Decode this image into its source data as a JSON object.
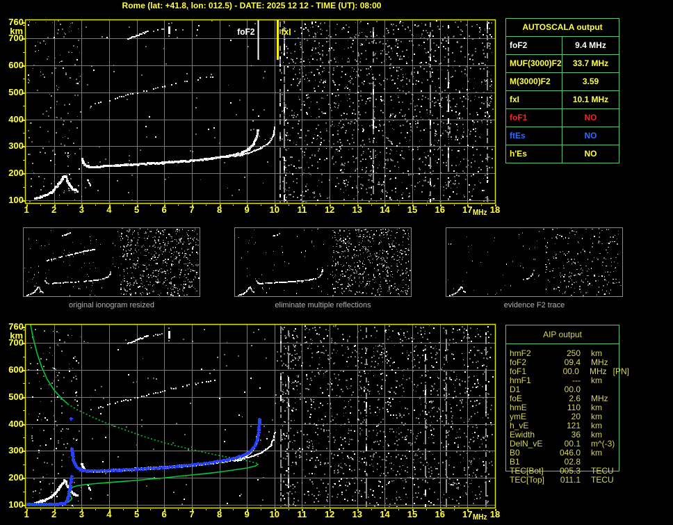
{
  "title": "Rome (lat: +41.8, lon: 012.5) - DATE: 2025 12 12 - TIME (UT): 08:00",
  "colors": {
    "yellow": "#ffff3c",
    "white": "#ffffff",
    "red": "#ff2020",
    "blue": "#2e6bff",
    "axis": "#e3e300",
    "grid": "#7a7a7a",
    "table_border": "#58c878",
    "trace_green": "#00c837",
    "trace_blue": "#2642ff",
    "caption": "#b4b4b4",
    "aip_text": "#d6d655"
  },
  "autoscala_table": {
    "title": "AUTOSCALA output",
    "rows": [
      {
        "label": "foF2",
        "value": "9.4 MHz",
        "color": "#ffffff"
      },
      {
        "label": "MUF(3000)F2",
        "value": "33.7 MHz",
        "color": "#ffff3c"
      },
      {
        "label": "M(3000)F2",
        "value": "3.59",
        "color": "#ffff3c"
      },
      {
        "label": "fxI",
        "value": "10.1 MHz",
        "color": "#ffff3c"
      },
      {
        "label": "foF1",
        "value": "NO",
        "color": "#ff2020"
      },
      {
        "label": "ftEs",
        "value": "NO",
        "color": "#2e6bff"
      },
      {
        "label": "h'Es",
        "value": "NO",
        "color": "#ffff3c"
      }
    ]
  },
  "aip_table": {
    "title": "AIP output",
    "rows": [
      {
        "label": "hmF2",
        "value": "250",
        "unit": "km",
        "note": ""
      },
      {
        "label": "foF2",
        "value": "09.4",
        "unit": "MHz",
        "note": ""
      },
      {
        "label": "foF1",
        "value": "00.0",
        "unit": "MHz",
        "note": "[PN]"
      },
      {
        "label": "hmF1",
        "value": "---",
        "unit": "km",
        "note": ""
      },
      {
        "label": "D1",
        "value": "00.0",
        "unit": "",
        "note": ""
      },
      {
        "label": "foE",
        "value": "2.6",
        "unit": "MHz",
        "note": ""
      },
      {
        "label": "hmE",
        "value": "110",
        "unit": "km",
        "note": ""
      },
      {
        "label": "ymE",
        "value": "20",
        "unit": "km",
        "note": ""
      },
      {
        "label": "h_vE",
        "value": "121",
        "unit": "km",
        "note": ""
      },
      {
        "label": "Ewidth",
        "value": "36",
        "unit": "km",
        "note": ""
      },
      {
        "label": "DelN_vE",
        "value": "00.1",
        "unit": "m^(-3)",
        "note": ""
      },
      {
        "label": "B0",
        "value": "046.0",
        "unit": "km",
        "note": ""
      },
      {
        "label": "B1",
        "value": "02.8",
        "unit": "",
        "note": ""
      },
      {
        "label": "TEC[Bot]",
        "value": "005.3",
        "unit": "TECU",
        "note": ""
      },
      {
        "label": "TEC[Top]",
        "value": "011.1",
        "unit": "TECU",
        "note": ""
      }
    ]
  },
  "thumbnails": {
    "items": [
      {
        "caption": "original ionogram resized",
        "traces": [
          "E-trace",
          "F2-O",
          "second-hop",
          "interference-streak"
        ],
        "noise_right": 1.0,
        "noise_left": 0.5,
        "skip": 0.25
      },
      {
        "caption": "eliminate multiple reflections",
        "traces": [
          "E-trace",
          "F2-O",
          "interference-streak"
        ],
        "noise_right": 1.0,
        "noise_left": 0.35,
        "skip": 0.25
      },
      {
        "caption": "evidence F2 trace",
        "traces": [
          "E-trace",
          "F2-end"
        ],
        "noise_right": 0.45,
        "noise_left": 0.25,
        "skip": 0.5
      }
    ]
  },
  "ionogram_traces": {
    "E-trace": {
      "style": "thick",
      "points": [
        [
          1.3,
          106
        ],
        [
          1.45,
          110
        ],
        [
          1.6,
          115
        ],
        [
          1.75,
          121
        ],
        [
          1.9,
          129
        ],
        [
          2.0,
          138
        ],
        [
          2.1,
          150
        ],
        [
          2.2,
          164
        ],
        [
          2.3,
          178
        ],
        [
          2.38,
          190
        ],
        [
          2.44,
          184
        ],
        [
          2.5,
          170
        ],
        [
          2.56,
          158
        ],
        [
          2.64,
          147
        ],
        [
          2.74,
          139
        ],
        [
          2.84,
          134
        ]
      ]
    },
    "E-fragment": {
      "style": "thin",
      "points": [
        [
          3.22,
          176
        ],
        [
          3.28,
          164
        ],
        [
          3.33,
          153
        ]
      ]
    },
    "F2-O": {
      "style": "thick",
      "points": [
        [
          3.02,
          252
        ],
        [
          3.07,
          240
        ],
        [
          3.12,
          231
        ],
        [
          3.2,
          226
        ],
        [
          3.35,
          223
        ],
        [
          3.6,
          224
        ],
        [
          4.0,
          227
        ],
        [
          4.5,
          230
        ],
        [
          5.0,
          233
        ],
        [
          5.5,
          236
        ],
        [
          6.0,
          239
        ],
        [
          6.5,
          243
        ],
        [
          7.0,
          247
        ],
        [
          7.5,
          252
        ],
        [
          8.0,
          258
        ],
        [
          8.4,
          265
        ],
        [
          8.7,
          272
        ],
        [
          8.95,
          281
        ],
        [
          9.1,
          291
        ],
        [
          9.2,
          303
        ],
        [
          9.3,
          319
        ],
        [
          9.36,
          338
        ],
        [
          9.41,
          360
        ]
      ]
    },
    "F2-X": {
      "style": "thin",
      "points": [
        [
          8.55,
          262
        ],
        [
          8.8,
          268
        ],
        [
          9.05,
          275
        ],
        [
          9.3,
          284
        ],
        [
          9.55,
          295
        ],
        [
          9.75,
          308
        ],
        [
          9.88,
          324
        ],
        [
          9.97,
          344
        ],
        [
          10.02,
          368
        ]
      ]
    },
    "second-hop": {
      "style": "speckle",
      "points": [
        [
          3.25,
          452
        ],
        [
          3.6,
          462
        ],
        [
          4.0,
          474
        ],
        [
          4.5,
          488
        ],
        [
          5.0,
          500
        ],
        [
          5.5,
          512
        ],
        [
          6.0,
          524
        ],
        [
          6.4,
          535
        ],
        [
          6.8,
          545
        ],
        [
          7.2,
          552
        ],
        [
          7.5,
          558
        ],
        [
          7.8,
          562
        ]
      ]
    },
    "interference-streak": {
      "style": "thin",
      "points": [
        [
          4.68,
          698
        ],
        [
          5.0,
          710
        ],
        [
          5.42,
          726
        ]
      ]
    },
    "streak-dots": {
      "style": "speckle",
      "points": [
        [
          5.5,
          729
        ],
        [
          5.75,
          734
        ],
        [
          5.95,
          738
        ]
      ]
    },
    "F2-end": {
      "style": "thin",
      "points": [
        [
          8.0,
          258
        ],
        [
          8.4,
          265
        ],
        [
          8.8,
          273
        ],
        [
          9.0,
          281
        ],
        [
          9.15,
          295
        ],
        [
          9.25,
          310
        ],
        [
          9.33,
          330
        ],
        [
          9.4,
          355
        ]
      ]
    }
  },
  "chart_data": [
    {
      "type": "scatter",
      "id": "scaled-ionogram",
      "xlabel": "MHz",
      "ylabel": "km",
      "xlim": [
        1,
        18
      ],
      "ylim": [
        100,
        760
      ],
      "grid": true,
      "x_ticks": [
        1,
        2,
        3,
        4,
        5,
        6,
        7,
        8,
        9,
        10,
        11,
        12,
        13,
        14,
        15,
        16,
        17,
        18
      ],
      "y_ticks": [
        100,
        200,
        300,
        400,
        500,
        600,
        700,
        760
      ],
      "white_traces": [
        "E-trace",
        "E-fragment",
        "F2-O",
        "F2-X",
        "second-hop",
        "interference-streak",
        "streak-dots"
      ],
      "markers": [
        {
          "label": "foF2",
          "x": 9.4,
          "color": "#ffffff",
          "label_side": "left",
          "width": 2
        },
        {
          "label": "fxI",
          "x": 10.1,
          "color": "#ffff00",
          "label_side": "right",
          "width": 3
        }
      ],
      "annotation": {
        "text": "i",
        "x": 6.15,
        "km": 732
      }
    },
    {
      "type": "scatter",
      "id": "aip-profile-ionogram",
      "xlabel": "MHz",
      "ylabel": "km",
      "xlim": [
        1,
        18
      ],
      "ylim": [
        100,
        760
      ],
      "grid": true,
      "x_ticks": [
        1,
        2,
        3,
        4,
        5,
        6,
        7,
        8,
        9,
        10,
        11,
        12,
        13,
        14,
        15,
        16,
        17,
        18
      ],
      "y_ticks": [
        100,
        200,
        300,
        400,
        500,
        600,
        700,
        760
      ],
      "white_traces": [
        "E-trace",
        "E-fragment",
        "F2-O",
        "F2-X",
        "second-hop",
        "interference-streak",
        "streak-dots"
      ],
      "markers": [],
      "annotation": {
        "text": "i",
        "x": 6.15,
        "km": 732
      },
      "overlays": {
        "profile": {
          "name": "electron-density-profile",
          "color": "#00c837",
          "topside_solid": [
            [
              1.15,
              768
            ],
            [
              1.25,
              716
            ],
            [
              1.38,
              664
            ],
            [
              1.55,
              612
            ],
            [
              1.75,
              566
            ],
            [
              2.0,
              526
            ],
            [
              2.28,
              494
            ],
            [
              2.5,
              474
            ]
          ],
          "topside_dotted": [
            [
              2.5,
              474
            ],
            [
              2.85,
              452
            ],
            [
              3.3,
              430
            ],
            [
              3.8,
              407
            ],
            [
              4.3,
              388
            ],
            [
              4.8,
              370
            ],
            [
              5.3,
              352
            ],
            [
              5.8,
              336
            ],
            [
              6.3,
              322
            ],
            [
              6.8,
              310
            ],
            [
              7.3,
              298
            ],
            [
              7.8,
              287
            ],
            [
              8.3,
              277
            ],
            [
              8.8,
              268
            ],
            [
              9.2,
              259
            ],
            [
              9.42,
              252
            ]
          ],
          "bottomside": [
            [
              9.42,
              252
            ],
            [
              9.3,
              244
            ],
            [
              9.0,
              237
            ],
            [
              8.5,
              229
            ],
            [
              8.0,
              222
            ],
            [
              7.5,
              216
            ],
            [
              7.0,
              211
            ],
            [
              6.5,
              206
            ],
            [
              6.0,
              200
            ],
            [
              5.5,
              196
            ],
            [
              5.0,
              191
            ],
            [
              4.5,
              187
            ],
            [
              4.0,
              183
            ],
            [
              3.5,
              179
            ],
            [
              3.1,
              175
            ],
            [
              2.85,
              171
            ],
            [
              2.68,
              166
            ],
            [
              2.6,
              158
            ],
            [
              2.56,
              147
            ],
            [
              2.57,
              137
            ],
            [
              2.62,
              130
            ],
            [
              2.65,
              124
            ],
            [
              2.6,
              117
            ],
            [
              2.52,
              111
            ],
            [
              2.4,
              106
            ],
            [
              2.2,
              103
            ],
            [
              1.9,
              101
            ],
            [
              1.5,
              100
            ],
            [
              1.1,
              100
            ]
          ]
        },
        "restored_trace": {
          "name": "autoscala-restored-trace",
          "color": "#2642ff",
          "segments": [
            [
              [
                1.0,
                104
              ],
              [
                1.2,
                104
              ],
              [
                1.4,
                104
              ],
              [
                1.6,
                104
              ],
              [
                1.8,
                104
              ],
              [
                2.0,
                104
              ],
              [
                2.15,
                104
              ],
              [
                2.3,
                105
              ],
              [
                2.4,
                107
              ]
            ],
            [
              [
                2.44,
                112
              ],
              [
                2.48,
                120
              ],
              [
                2.52,
                132
              ],
              [
                2.55,
                148
              ],
              [
                2.58,
                166
              ],
              [
                2.61,
                186
              ],
              [
                2.63,
                205
              ]
            ],
            [
              [
                2.62,
                420
              ]
            ],
            [
              [
                2.64,
                310
              ],
              [
                2.66,
                288
              ],
              [
                2.7,
                266
              ],
              [
                2.76,
                250
              ],
              [
                2.84,
                240
              ],
              [
                2.95,
                232
              ],
              [
                3.1,
                228
              ],
              [
                3.4,
                226
              ],
              [
                3.8,
                227
              ],
              [
                4.2,
                229
              ],
              [
                4.6,
                231
              ],
              [
                5.0,
                233
              ],
              [
                5.4,
                236
              ],
              [
                5.8,
                238
              ],
              [
                6.2,
                241
              ],
              [
                6.6,
                245
              ],
              [
                7.0,
                249
              ],
              [
                7.4,
                253
              ],
              [
                7.8,
                259
              ],
              [
                8.2,
                266
              ],
              [
                8.55,
                274
              ],
              [
                8.85,
                283
              ],
              [
                9.05,
                293
              ],
              [
                9.2,
                306
              ],
              [
                9.3,
                322
              ],
              [
                9.37,
                342
              ],
              [
                9.42,
                368
              ],
              [
                9.44,
                396
              ],
              [
                9.45,
                418
              ]
            ]
          ]
        }
      }
    }
  ]
}
